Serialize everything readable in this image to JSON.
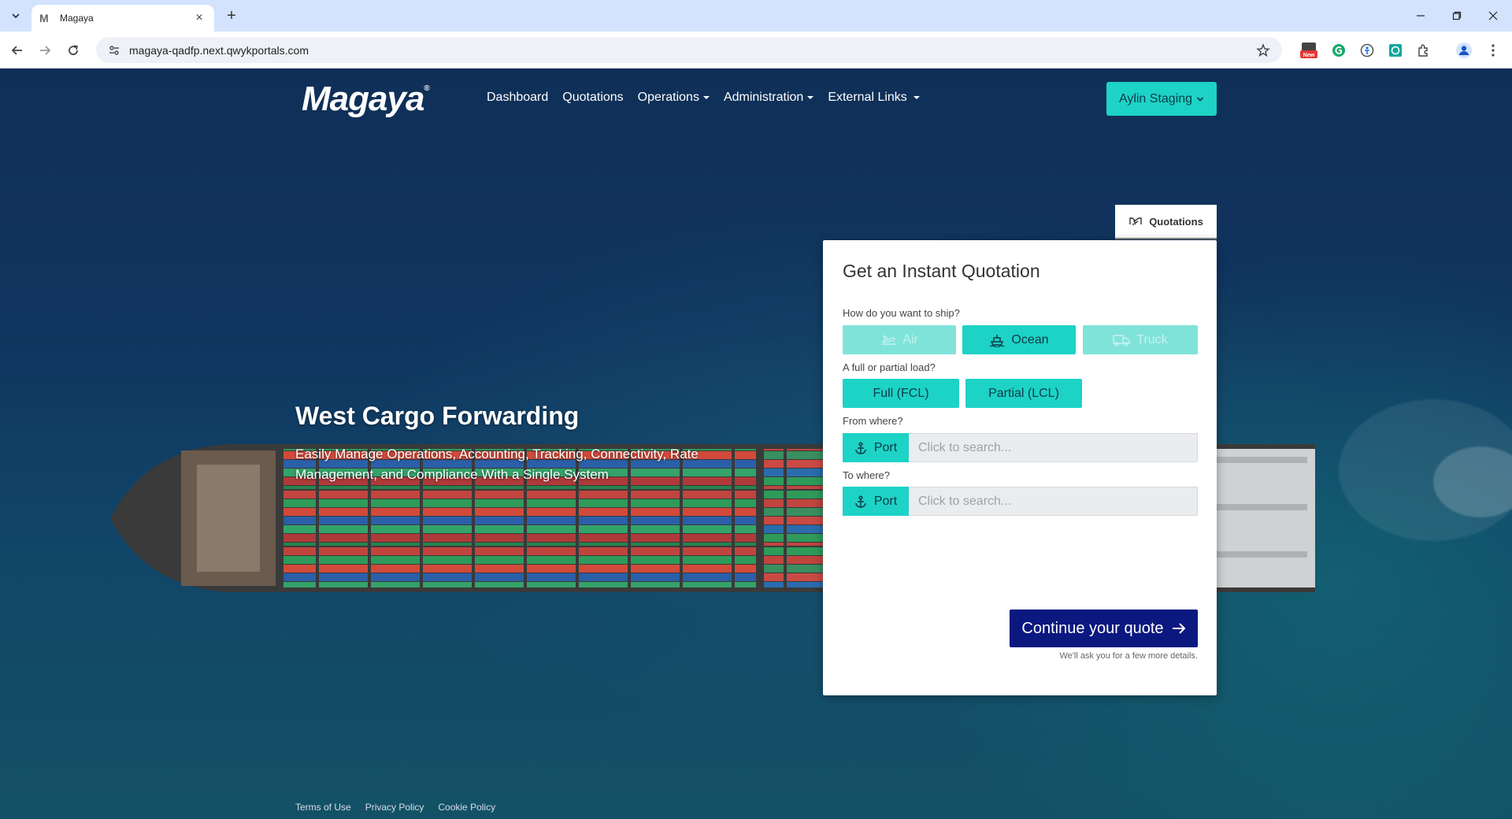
{
  "browser": {
    "tab_title": "Magaya",
    "tab_favicon": "M",
    "url": "magaya-qadfp.next.qwykportals.com"
  },
  "header": {
    "logo_text": "Magaya",
    "logo_mark": "®",
    "nav": [
      {
        "label": "Dashboard",
        "dropdown": false
      },
      {
        "label": "Quotations",
        "dropdown": false
      },
      {
        "label": "Operations",
        "dropdown": true
      },
      {
        "label": "Administration",
        "dropdown": true
      },
      {
        "label": "External Links",
        "dropdown": true
      }
    ],
    "user_button": "Aylin Staging"
  },
  "hero": {
    "title": "West Cargo Forwarding",
    "subtitle": "Easily Manage Operations, Accounting, Tracking, Connectivity, Rate Management, and Compliance With a Single System"
  },
  "quote": {
    "tab_label": "Quotations",
    "title": "Get an Instant Quotation",
    "ship_question": "How do you want to ship?",
    "modes": [
      {
        "label": "Air",
        "icon": "plane-icon",
        "selected": false
      },
      {
        "label": "Ocean",
        "icon": "ship-icon",
        "selected": true
      },
      {
        "label": "Truck",
        "icon": "truck-icon",
        "selected": false
      }
    ],
    "load_question": "A full or partial load?",
    "loads": [
      {
        "label": "Full (FCL)"
      },
      {
        "label": "Partial (LCL)"
      }
    ],
    "from_label": "From where?",
    "to_label": "To where?",
    "port_button": "Port",
    "search_placeholder": "Click to search...",
    "continue_label": "Continue your quote",
    "continue_hint": "We'll ask you for a few more details."
  },
  "footer": {
    "links": [
      "Terms of Use",
      "Privacy Policy",
      "Cookie Policy"
    ]
  },
  "colors": {
    "accent": "#1dd3c5",
    "accent_dim": "#80e3da",
    "primary_button": "#0b1880",
    "browser_tabbar": "#d3e3fd"
  }
}
